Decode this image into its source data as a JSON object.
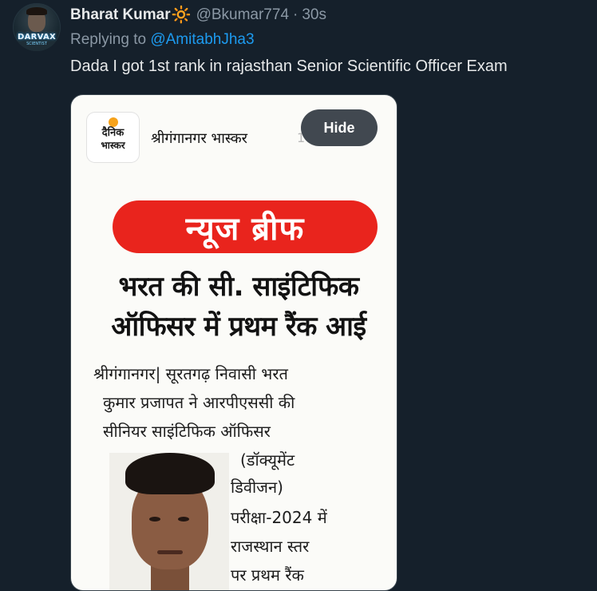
{
  "tweet": {
    "avatar_text": "DARVAX",
    "avatar_subtext": "SCIENTIST",
    "display_name": "Bharat Kumar",
    "name_emoji": "🔆",
    "handle": "@Bkumar774",
    "separator": "·",
    "time": "30s",
    "replying_prefix": "Replying to ",
    "replying_to": "@AmitabhJha3",
    "text": "Dada I got 1st rank in rajasthan Senior Scientific Officer Exam"
  },
  "media": {
    "logo_line1": "दैनिक",
    "logo_line2": "भास्कर",
    "source_name": "श्रीगंगानगर भास्कर",
    "source_date_fragment": "1          6",
    "hide_label": "Hide",
    "brief_label": "न्यूज ब्रीफ",
    "headline_line1": "भरत की सी. साइंटिफिक",
    "headline_line2": "ऑफिसर में प्रथम रैंक आई",
    "body_lines": [
      "श्रीगंगानगर| सूरतगढ़ निवासी भरत",
      "कुमार प्रजापत ने आरपीएससी की",
      "सीनियर साइंटिफिक ऑफिसर",
      "(डॉक्यूमेंट",
      "डिवीजन)",
      "परीक्षा-2024 में",
      "राजस्थान स्तर",
      "पर प्रथम रैंक"
    ]
  },
  "colors": {
    "background": "#15202b",
    "mention": "#1d9bf0",
    "banner_red": "#e9241d"
  }
}
